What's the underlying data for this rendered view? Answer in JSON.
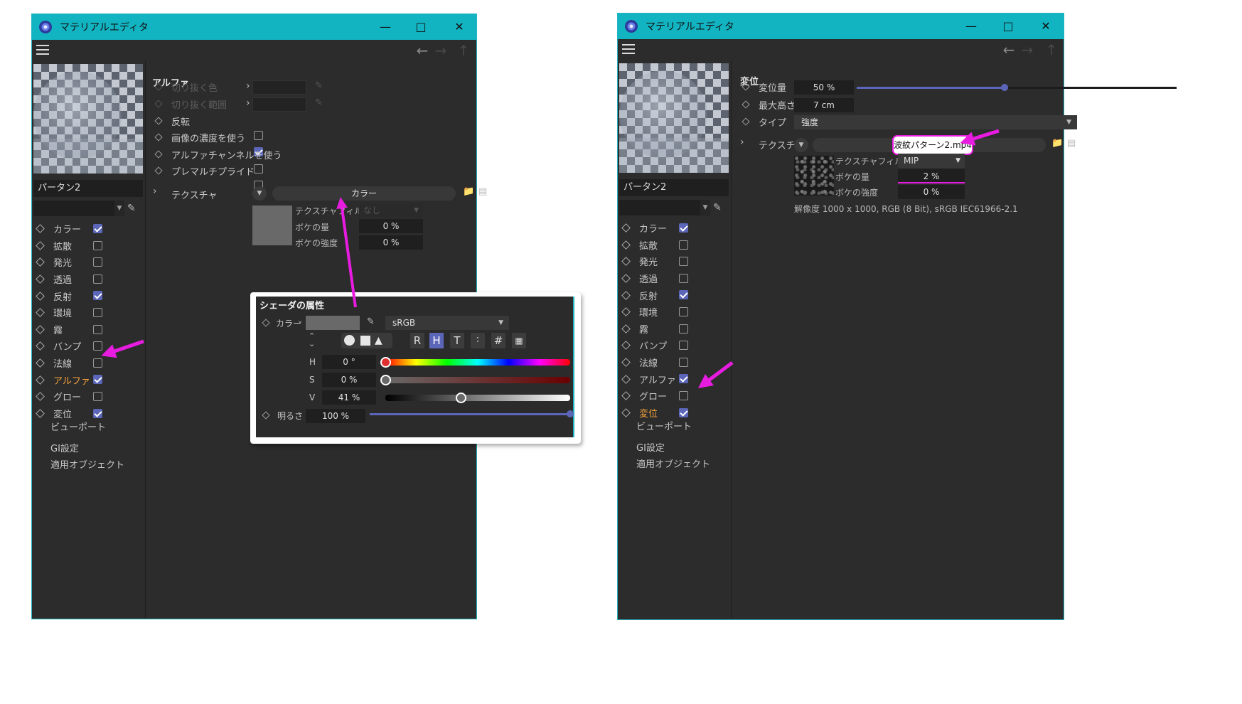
{
  "window_title": "マテリアルエディタ",
  "left_window": {
    "material_name": "パータン2",
    "channels": [
      {
        "label": "カラー",
        "checked": true
      },
      {
        "label": "拡散",
        "checked": false
      },
      {
        "label": "発光",
        "checked": false
      },
      {
        "label": "透過",
        "checked": false
      },
      {
        "label": "反射",
        "checked": true
      },
      {
        "label": "環境",
        "checked": false
      },
      {
        "label": "霧",
        "checked": false
      },
      {
        "label": "バンプ",
        "checked": false
      },
      {
        "label": "法線",
        "checked": false
      },
      {
        "label": "アルファ",
        "checked": true,
        "active": true
      },
      {
        "label": "グロー",
        "checked": false
      },
      {
        "label": "変位",
        "checked": true
      }
    ],
    "extras": [
      "ビューポート",
      "GI設定",
      "適用オブジェクト"
    ],
    "section_title": "アルファ",
    "props": {
      "cut_color": "切り抜く色",
      "cut_range": "切り抜く範囲",
      "invert": "反転",
      "use_image_density": "画像の濃度を使う",
      "use_alpha_channel": "アルファチャンネルを使う",
      "premultiplied": "プレマルチプライド",
      "texture": "テクスチャ"
    },
    "texture_name": "カラー",
    "texture_filter_label": "テクスチャフィルタ",
    "texture_filter_value": "なし",
    "blur_amount_label": "ボケの量",
    "blur_amount_value": "0 %",
    "blur_strength_label": "ボケの強度",
    "blur_strength_value": "0 %"
  },
  "shader_popup": {
    "title": "シェーダの属性",
    "color_label": "カラー",
    "colorspace": "sRGB",
    "mode_buttons": [
      "R",
      "H",
      "T",
      "#"
    ],
    "h_label": "H",
    "h_value": "0 °",
    "h": 0,
    "s_label": "S",
    "s_value": "0 %",
    "s": 0,
    "v_label": "V",
    "v_value": "41 %",
    "v": 41,
    "brightness_label": "明るさ",
    "brightness_value": "100 %",
    "brightness": 100
  },
  "right_window": {
    "material_name": "パータン2",
    "channels": [
      {
        "label": "カラー",
        "checked": true
      },
      {
        "label": "拡散",
        "checked": false
      },
      {
        "label": "発光",
        "checked": false
      },
      {
        "label": "透過",
        "checked": false
      },
      {
        "label": "反射",
        "checked": true
      },
      {
        "label": "環境",
        "checked": false
      },
      {
        "label": "霧",
        "checked": false
      },
      {
        "label": "バンプ",
        "checked": false
      },
      {
        "label": "法線",
        "checked": false
      },
      {
        "label": "アルファ",
        "checked": true
      },
      {
        "label": "グロー",
        "checked": false
      },
      {
        "label": "変位",
        "checked": true,
        "active": true
      }
    ],
    "extras": [
      "ビューポート",
      "GI設定",
      "適用オブジェクト"
    ],
    "section_title": "変位",
    "amount_label": "変位量",
    "amount_value": "50 %",
    "amount": 50,
    "max_height_label": "最大高さ",
    "max_height_value": "7 cm",
    "type_label": "タイプ",
    "type_value": "強度",
    "texture_label": "テクスチャ",
    "texture_file": "波紋パターン2.mp4",
    "texture_filter_label": "テクスチャフィルタ",
    "texture_filter_value": "MIP",
    "blur_amount_label": "ボケの量",
    "blur_amount_value": "2 %",
    "blur_strength_label": "ボケの強度",
    "blur_strength_value": "0 %",
    "resolution": "解像度 1000 x 1000, RGB (8 Bit), sRGB IEC61966-2.1"
  },
  "colors": {
    "titlebar": "#13b4c2",
    "panel": "#2c2c2c",
    "checkbox_on": "#5b66b8",
    "active_label": "#f6a43c",
    "annotation": "#e81ce0"
  }
}
